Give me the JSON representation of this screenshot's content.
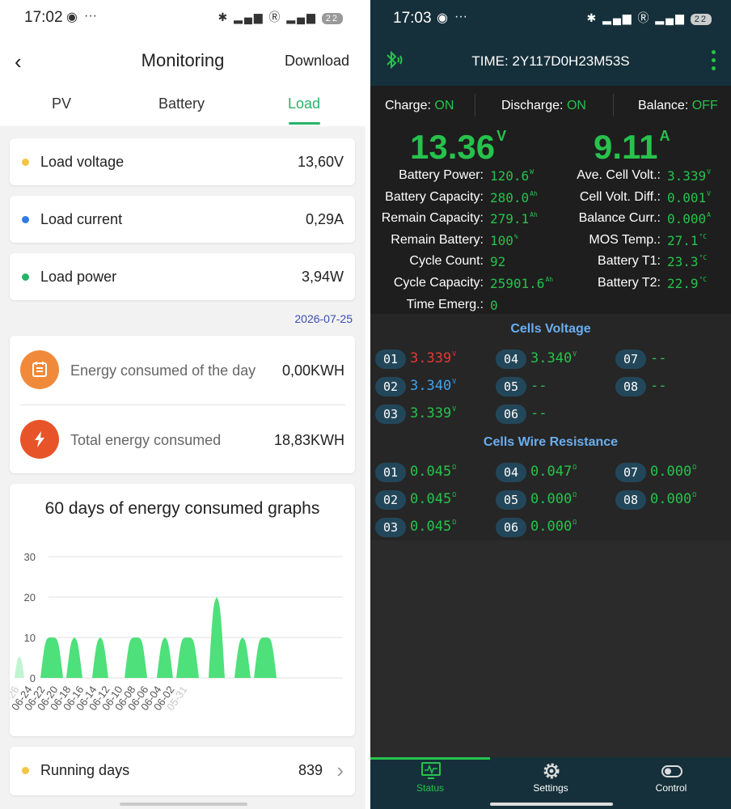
{
  "left": {
    "status": {
      "time": "17:02",
      "battery": "22"
    },
    "header": {
      "title": "Monitoring",
      "download": "Download"
    },
    "tabs": [
      {
        "label": "PV",
        "active": false
      },
      {
        "label": "Battery",
        "active": false
      },
      {
        "label": "Load",
        "active": true
      }
    ],
    "metrics": [
      {
        "label": "Load voltage",
        "value": "13,60V",
        "color": "#f4c542"
      },
      {
        "label": "Load current",
        "value": "0,29A",
        "color": "#2e7ce6"
      },
      {
        "label": "Load power",
        "value": "3,94W",
        "color": "#27b36a"
      }
    ],
    "date": "2026-07-25",
    "energy": [
      {
        "label": "Energy consumed of the day",
        "value": "0,00KWH",
        "icon": "calendar-icon",
        "color": "#f08a3a"
      },
      {
        "label": "Total energy consumed",
        "value": "18,83KWH",
        "icon": "lightning-icon",
        "color": "#e8542a"
      }
    ],
    "chart_title": "60 days of energy consumed graphs",
    "running": {
      "label": "Running days",
      "value": "839"
    },
    "accent_color": "#27b36a"
  },
  "chart_data": {
    "type": "area",
    "title": "60 days of energy consumed graphs",
    "xlabel": "",
    "ylabel": "",
    "ylim": [
      0,
      30
    ],
    "yticks": [
      0,
      10,
      20,
      30
    ],
    "grid": true,
    "categories": [
      "05-26",
      "06-24",
      "06-22",
      "06-20",
      "06-18",
      "06-16",
      "06-14",
      "06-12",
      "06-10",
      "06-08",
      "06-06",
      "06-04",
      "06-02",
      "05-31"
    ],
    "tick_values": [
      0,
      2,
      4,
      6,
      8,
      10,
      12,
      14,
      16,
      18,
      20,
      22,
      24,
      26
    ],
    "values_by_day": [
      10,
      0,
      0,
      0,
      10,
      10,
      10,
      0,
      10,
      10,
      0,
      0,
      10,
      10,
      0,
      0,
      0,
      10,
      10,
      10,
      0,
      0,
      10,
      10,
      0,
      10,
      10,
      10,
      0,
      0,
      20,
      20,
      0,
      0,
      10,
      10,
      0,
      10,
      10,
      10,
      0,
      0,
      0,
      0,
      0,
      0,
      0,
      0,
      0,
      0,
      0
    ],
    "series_color": "#4ee07a"
  },
  "right": {
    "status": {
      "time": "17:03",
      "battery": "22"
    },
    "header": {
      "time_label": "TIME: 2Y117D0H23M53S"
    },
    "states": [
      {
        "label": "Charge:",
        "value": "ON"
      },
      {
        "label": "Discharge:",
        "value": "ON"
      },
      {
        "label": "Balance:",
        "value": "OFF"
      }
    ],
    "voltage": {
      "value": "13.36",
      "unit": "V"
    },
    "current": {
      "value": "9.11",
      "unit": "A"
    },
    "left_params": [
      {
        "label": "Battery Power:",
        "value": "120.6",
        "unit": "W"
      },
      {
        "label": "Battery Capacity:",
        "value": "280.0",
        "unit": "Ah"
      },
      {
        "label": "Remain Capacity:",
        "value": "279.1",
        "unit": "Ah"
      },
      {
        "label": "Remain Battery:",
        "value": "100",
        "unit": "%"
      },
      {
        "label": "Cycle Count:",
        "value": "92",
        "unit": ""
      },
      {
        "label": "Cycle Capacity:",
        "value": "25901.6",
        "unit": "Ah"
      },
      {
        "label": "Time Emerg.:",
        "value": "0",
        "unit": ""
      }
    ],
    "right_params": [
      {
        "label": "Ave. Cell Volt.:",
        "value": "3.339",
        "unit": "V"
      },
      {
        "label": "Cell Volt. Diff.:",
        "value": "0.001",
        "unit": "V"
      },
      {
        "label": "Balance Curr.:",
        "value": "0.000",
        "unit": "A"
      },
      {
        "label": "MOS Temp.:",
        "value": "27.1",
        "unit": "°C"
      },
      {
        "label": "Battery T1:",
        "value": "23.3",
        "unit": "°C"
      },
      {
        "label": "Battery T2:",
        "value": "22.9",
        "unit": "°C"
      }
    ],
    "cells_voltage": {
      "title": "Cells Voltage",
      "cells": [
        {
          "id": "01",
          "value": "3.339",
          "unit": "V",
          "color": "#e53935"
        },
        {
          "id": "02",
          "value": "3.340",
          "unit": "V",
          "color": "#3fa3f0"
        },
        {
          "id": "03",
          "value": "3.339",
          "unit": "V",
          "color": "#27c24c"
        },
        {
          "id": "04",
          "value": "3.340",
          "unit": "V",
          "color": "#27c24c"
        },
        {
          "id": "05",
          "value": "--",
          "unit": "",
          "color": "#27c24c"
        },
        {
          "id": "06",
          "value": "--",
          "unit": "",
          "color": "#27c24c"
        },
        {
          "id": "07",
          "value": "--",
          "unit": "",
          "color": "#27c24c"
        },
        {
          "id": "08",
          "value": "--",
          "unit": "",
          "color": "#27c24c"
        }
      ]
    },
    "cells_resistance": {
      "title": "Cells Wire Resistance",
      "cells": [
        {
          "id": "01",
          "value": "0.045",
          "unit": "Ω"
        },
        {
          "id": "02",
          "value": "0.045",
          "unit": "Ω"
        },
        {
          "id": "03",
          "value": "0.045",
          "unit": "Ω"
        },
        {
          "id": "04",
          "value": "0.047",
          "unit": "Ω"
        },
        {
          "id": "05",
          "value": "0.000",
          "unit": "Ω"
        },
        {
          "id": "06",
          "value": "0.000",
          "unit": "Ω"
        },
        {
          "id": "07",
          "value": "0.000",
          "unit": "Ω"
        },
        {
          "id": "08",
          "value": "0.000",
          "unit": "Ω"
        }
      ]
    },
    "nav": [
      {
        "label": "Status",
        "icon": "monitor-icon",
        "active": true
      },
      {
        "label": "Settings",
        "icon": "gear-icon",
        "active": false
      },
      {
        "label": "Control",
        "icon": "toggle-icon",
        "active": false
      }
    ],
    "accent_color": "#27c24c"
  }
}
